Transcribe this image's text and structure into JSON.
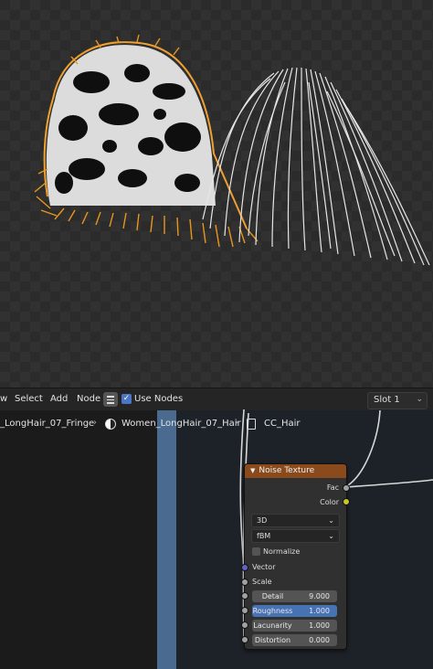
{
  "header": {
    "menu_edge": "w",
    "menu_select": "Select",
    "menu_add": "Add",
    "menu_node": "Node",
    "use_nodes_label": "Use Nodes",
    "use_nodes_checked": true,
    "slot_value": "Slot 1"
  },
  "breadcrumb": {
    "item1": "_LongHair_07_Fringe",
    "item2": "Women_LongHair_07_Hair",
    "item3": "CC_Hair"
  },
  "node": {
    "title": "Noise Texture",
    "outputs": [
      "Fac",
      "Color"
    ],
    "dimensions": "3D",
    "type": "fBM",
    "normalize_label": "Normalize",
    "vector_label": "Vector",
    "scale_label": "Scale",
    "fields": [
      {
        "label": "Detail",
        "value": "9.000"
      },
      {
        "label": "Roughness",
        "value": "1.000"
      },
      {
        "label": "Lacunarity",
        "value": "1.000"
      },
      {
        "label": "Distortion",
        "value": "0.000"
      }
    ]
  },
  "colors": {
    "node_header": "#8a4a1c",
    "selection_outline": "#f0a030",
    "active_field": "#4772b3",
    "fac_socket": "#a1a1a1",
    "color_socket": "#c7c729",
    "vector_socket": "#6363c7"
  }
}
